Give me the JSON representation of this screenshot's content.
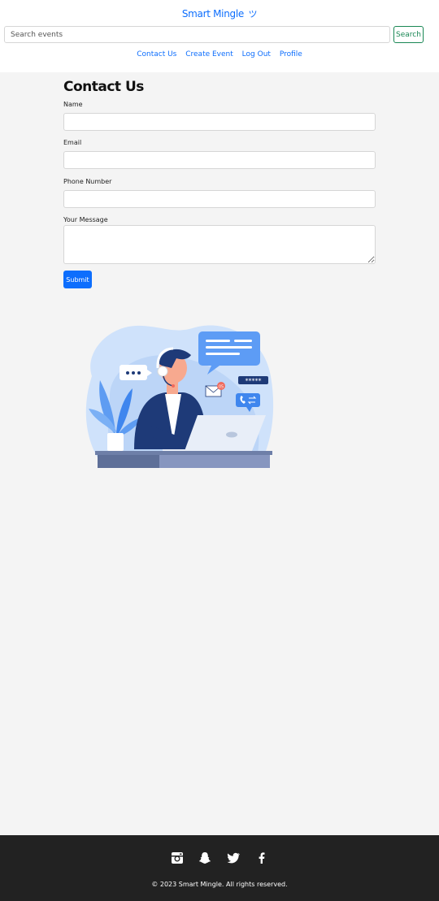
{
  "header": {
    "brand": "Smart Mingle",
    "brand_icon": "smile-icon",
    "search": {
      "placeholder": "Search events",
      "value": "",
      "button_label": "Search"
    },
    "nav": [
      {
        "label": "Contact Us"
      },
      {
        "label": "Create Event"
      },
      {
        "label": "Log Out"
      },
      {
        "label": "Profile"
      }
    ]
  },
  "form": {
    "title": "Contact Us",
    "fields": {
      "name": {
        "label": "Name",
        "value": ""
      },
      "email": {
        "label": "Email",
        "value": ""
      },
      "phone": {
        "label": "Phone Number",
        "value": ""
      },
      "message": {
        "label": "Your Message",
        "value": ""
      }
    },
    "submit_label": "Submit"
  },
  "illustration": {
    "subject": "customer-support-agent-illustration",
    "badge_count": "05",
    "password_mask": "*****"
  },
  "footer": {
    "social": [
      {
        "icon": "instagram-icon"
      },
      {
        "icon": "snapchat-icon"
      },
      {
        "icon": "twitter-icon"
      },
      {
        "icon": "facebook-icon"
      }
    ],
    "copyright": "© 2023 Smart Mingle. All rights reserved."
  },
  "colors": {
    "primary": "#0d6efd",
    "success": "#198754",
    "footer_bg": "#222222",
    "page_bg": "#f4f4f4"
  }
}
